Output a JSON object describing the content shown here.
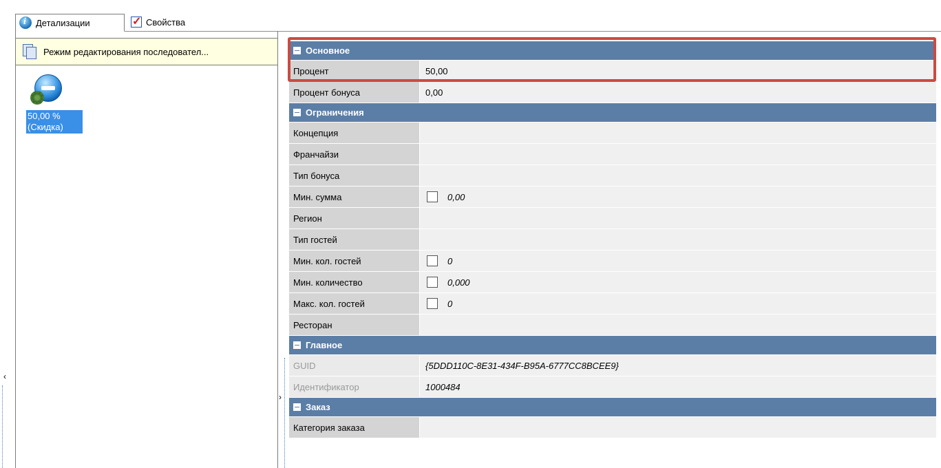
{
  "tabs": [
    {
      "label": "Детализации",
      "icon": "info-icon"
    },
    {
      "label": "Свойства",
      "icon": "properties-checkbox-icon"
    }
  ],
  "left": {
    "mode_text": "Режим редактирования последовател...",
    "node_line1": "50,00 %",
    "node_line2": "(Скидка)"
  },
  "grid": {
    "main": {
      "title": "Основное",
      "rows": [
        {
          "name": "Процент",
          "value": "50,00"
        },
        {
          "name": "Процент бонуса",
          "value": "0,00"
        }
      ]
    },
    "limits": {
      "title": "Ограничения",
      "rows": [
        {
          "name": "Концепция",
          "value": ""
        },
        {
          "name": "Франчайзи",
          "value": ""
        },
        {
          "name": "Тип бонуса",
          "value": ""
        },
        {
          "name": "Мин. сумма",
          "value": "0,00"
        },
        {
          "name": "Регион",
          "value": ""
        },
        {
          "name": "Тип гостей",
          "value": ""
        },
        {
          "name": "Мин. кол. гостей",
          "value": "0"
        },
        {
          "name": "Мин. количество",
          "value": "0,000"
        },
        {
          "name": "Макс. кол. гостей",
          "value": "0"
        },
        {
          "name": "Ресторан",
          "value": ""
        }
      ]
    },
    "general": {
      "title": "Главное",
      "rows": [
        {
          "name": "GUID",
          "value": "{5DDD110C-8E31-434F-B95A-6777CC8BCEE9}"
        },
        {
          "name": "Идентификатор",
          "value": "1000484"
        }
      ]
    },
    "order": {
      "title": "Заказ",
      "rows": [
        {
          "name": "Категория заказа",
          "value": ""
        }
      ]
    }
  },
  "colors": {
    "category_header": "#5b7ea6",
    "highlight": "#cc4a40",
    "selection": "#3a8fe6"
  }
}
